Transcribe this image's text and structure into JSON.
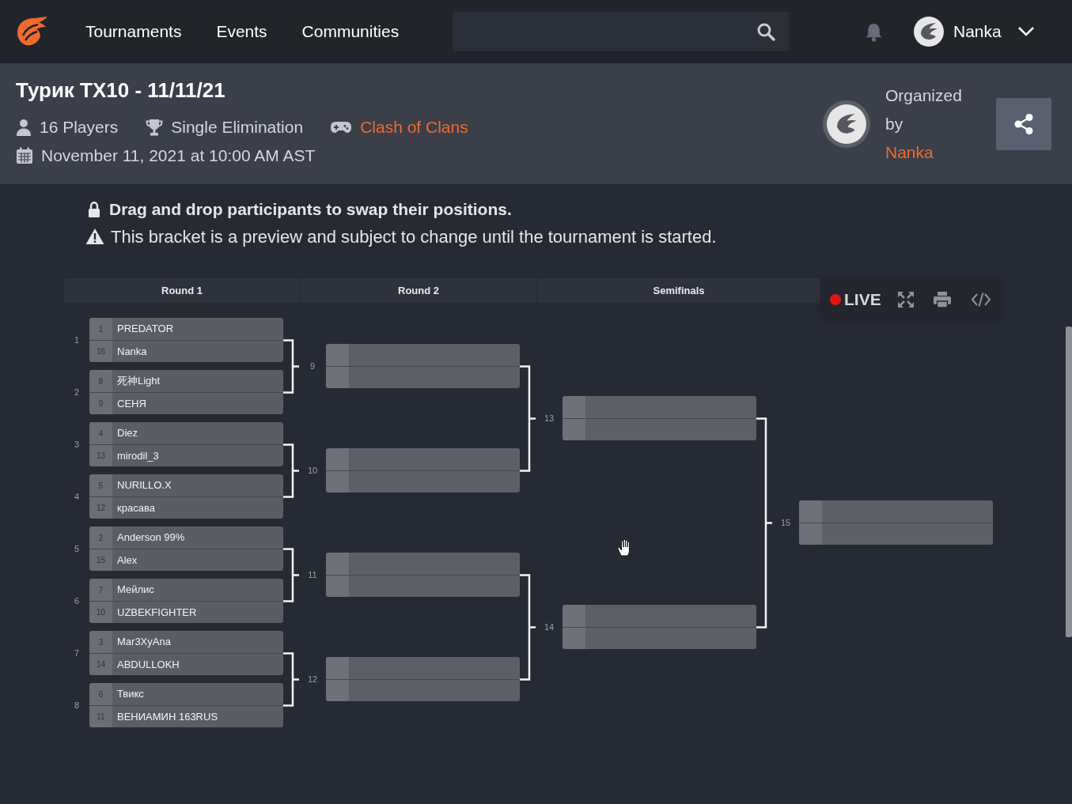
{
  "nav": {
    "links": [
      "Tournaments",
      "Events",
      "Communities"
    ],
    "user": "Nanka"
  },
  "tournament": {
    "title": "Турик TX10 - 11/11/21",
    "players": "16 Players",
    "format": "Single Elimination",
    "game": "Clash of Clans",
    "date": "November 11, 2021 at 10:00 AM AST",
    "organizer": {
      "label": "Organized by",
      "name": "Nanka"
    }
  },
  "notices": [
    {
      "kind": "lock",
      "text": "Drag and drop participants to swap their positions."
    },
    {
      "kind": "warning",
      "text": "This bracket is a preview and subject to change until the tournament is started."
    }
  ],
  "bracket": {
    "columns": [
      "Round 1",
      "Round 2",
      "Semifinals"
    ],
    "toolbar": {
      "live": "LIVE"
    },
    "rounds": [
      {
        "matches": [
          {
            "number": "1",
            "players": [
              {
                "seed": "1",
                "name": "PREDATOR"
              },
              {
                "seed": "16",
                "name": "Nanka"
              }
            ]
          },
          {
            "number": "2",
            "players": [
              {
                "seed": "8",
                "name": "死神Light"
              },
              {
                "seed": "9",
                "name": "СЕНЯ"
              }
            ]
          },
          {
            "number": "3",
            "players": [
              {
                "seed": "4",
                "name": "Diez"
              },
              {
                "seed": "13",
                "name": "mirodil_3"
              }
            ]
          },
          {
            "number": "4",
            "players": [
              {
                "seed": "5",
                "name": "NURILLO.X"
              },
              {
                "seed": "12",
                "name": "красава"
              }
            ]
          },
          {
            "number": "5",
            "players": [
              {
                "seed": "2",
                "name": "Anderson 99%"
              },
              {
                "seed": "15",
                "name": "Alex"
              }
            ]
          },
          {
            "number": "6",
            "players": [
              {
                "seed": "7",
                "name": "Мейлис"
              },
              {
                "seed": "10",
                "name": "UZBEKFIGHTER"
              }
            ]
          },
          {
            "number": "7",
            "players": [
              {
                "seed": "3",
                "name": "Mar3XyAna"
              },
              {
                "seed": "14",
                "name": "ABDULLOKH"
              }
            ]
          },
          {
            "number": "8",
            "players": [
              {
                "seed": "6",
                "name": "Твикс"
              },
              {
                "seed": "11",
                "name": "ВЕНИАМИН 163RUS"
              }
            ]
          }
        ]
      },
      {
        "matches": [
          {
            "number": "9"
          },
          {
            "number": "10"
          },
          {
            "number": "11"
          },
          {
            "number": "12"
          }
        ]
      },
      {
        "matches": [
          {
            "number": "13"
          },
          {
            "number": "14"
          }
        ]
      },
      {
        "matches": [
          {
            "number": "15"
          }
        ]
      }
    ]
  }
}
